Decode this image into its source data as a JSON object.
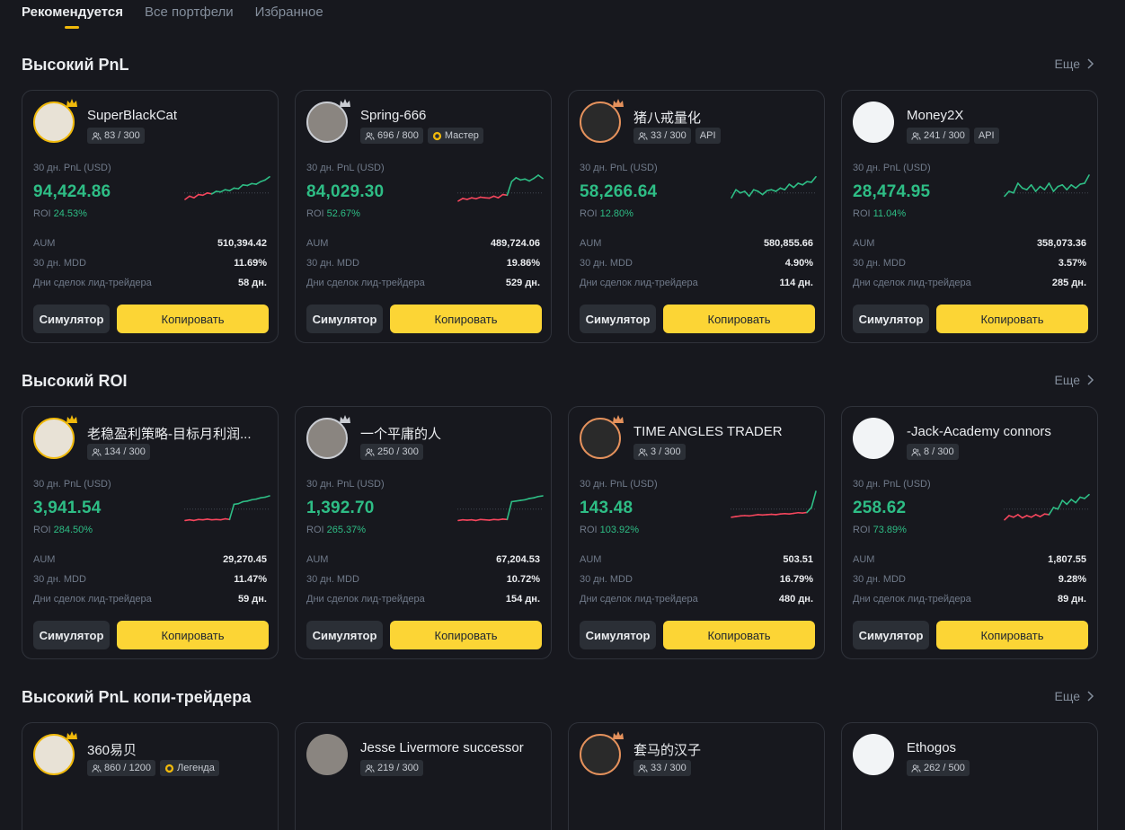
{
  "tabs": [
    {
      "label": "Рекомендуется",
      "active": true
    },
    {
      "label": "Все портфели",
      "active": false
    },
    {
      "label": "Избранное",
      "active": false
    }
  ],
  "labels": {
    "pnl": "30 дн. PnL (USD)",
    "roi": "ROI",
    "aum": "AUM",
    "mdd": "30 дн. MDD",
    "days": "Дни сделок лид-трейдера",
    "simulator": "Симулятор",
    "copy": "Копировать",
    "more": "Еще"
  },
  "colors": {
    "accent": "#fcd535",
    "profit": "#2ebd85",
    "loss": "#f6465d",
    "gold_frame": "#f0b90b",
    "silver_frame": "#c9ccd2",
    "bronze_frame": "#e4915c"
  },
  "sections": [
    {
      "title": "Высокий PnL",
      "cards": [
        {
          "name": "SuperBlackCat",
          "followers": "83 / 300",
          "tag": "",
          "tag_icon": "",
          "frame": "gold",
          "pnl": "94,424.86",
          "roi": "24.53%",
          "aum": "510,394.42",
          "mdd": "11.69%",
          "days": "58 дн.",
          "spark": [
            0.25,
            0.35,
            0.3,
            0.4,
            0.38,
            0.45,
            0.42,
            0.5,
            0.48,
            0.55,
            0.52,
            0.6,
            0.58,
            0.7,
            0.68,
            0.74,
            0.72,
            0.8,
            0.85,
            0.95
          ]
        },
        {
          "name": "Spring-666",
          "followers": "696 / 800",
          "tag": "Мастер",
          "tag_icon": "medal-icon",
          "frame": "silver",
          "pnl": "84,029.30",
          "roi": "52.67%",
          "aum": "489,724.06",
          "mdd": "19.86%",
          "days": "529 дн.",
          "spark": [
            0.2,
            0.28,
            0.25,
            0.3,
            0.27,
            0.32,
            0.3,
            0.29,
            0.35,
            0.3,
            0.4,
            0.38,
            0.8,
            0.92,
            0.85,
            0.88,
            0.82,
            0.9,
            1.0,
            0.9
          ]
        },
        {
          "name": "猪八戒量化",
          "followers": "33 / 300",
          "tag": "API",
          "tag_icon": "",
          "frame": "bronze",
          "pnl": "58,266.64",
          "roi": "12.80%",
          "aum": "580,855.66",
          "mdd": "4.90%",
          "days": "114 дн.",
          "spark": [
            0.3,
            0.55,
            0.45,
            0.5,
            0.35,
            0.55,
            0.5,
            0.4,
            0.52,
            0.55,
            0.5,
            0.6,
            0.55,
            0.72,
            0.62,
            0.75,
            0.7,
            0.8,
            0.78,
            0.95
          ]
        },
        {
          "name": "Money2X",
          "followers": "241 / 300",
          "tag": "API",
          "tag_icon": "",
          "frame": "none",
          "pnl": "28,474.95",
          "roi": "11.04%",
          "aum": "358,073.36",
          "mdd": "3.57%",
          "days": "285 дн.",
          "spark": [
            0.35,
            0.5,
            0.45,
            0.75,
            0.6,
            0.55,
            0.7,
            0.5,
            0.65,
            0.55,
            0.75,
            0.5,
            0.65,
            0.7,
            0.55,
            0.7,
            0.6,
            0.72,
            0.75,
            1.0
          ]
        }
      ]
    },
    {
      "title": "Высокий ROI",
      "cards": [
        {
          "name": "老稳盈利策略-目标月利润...",
          "followers": "134 / 300",
          "tag": "",
          "tag_icon": "",
          "frame": "gold",
          "pnl": "3,941.54",
          "roi": "284.50%",
          "aum": "29,270.45",
          "mdd": "11.47%",
          "days": "59 дн.",
          "spark": [
            0.1,
            0.12,
            0.1,
            0.13,
            0.12,
            0.14,
            0.12,
            0.13,
            0.12,
            0.15,
            0.13,
            0.6,
            0.62,
            0.68,
            0.7,
            0.74,
            0.76,
            0.8,
            0.82,
            0.86
          ]
        },
        {
          "name": "一个平庸的人",
          "followers": "250 / 300",
          "tag": "",
          "tag_icon": "",
          "frame": "silver",
          "pnl": "1,392.70",
          "roi": "265.37%",
          "aum": "67,204.53",
          "mdd": "10.72%",
          "days": "154 дн.",
          "spark": [
            0.1,
            0.12,
            0.11,
            0.12,
            0.1,
            0.13,
            0.12,
            0.11,
            0.13,
            0.12,
            0.14,
            0.13,
            0.68,
            0.7,
            0.72,
            0.74,
            0.78,
            0.8,
            0.84,
            0.86
          ]
        },
        {
          "name": "TIME ANGLES TRADER",
          "followers": "3 / 300",
          "tag": "",
          "tag_icon": "",
          "frame": "bronze",
          "pnl": "143.48",
          "roi": "103.92%",
          "aum": "503.51",
          "mdd": "16.79%",
          "days": "480 дн.",
          "spark": [
            0.2,
            0.22,
            0.24,
            0.25,
            0.24,
            0.26,
            0.28,
            0.27,
            0.28,
            0.29,
            0.28,
            0.3,
            0.31,
            0.3,
            0.32,
            0.34,
            0.33,
            0.35,
            0.5,
            1.0
          ]
        },
        {
          "name": "-Jack-Academy connors",
          "followers": "8 / 300",
          "tag": "",
          "tag_icon": "",
          "frame": "none",
          "pnl": "258.62",
          "roi": "73.89%",
          "aum": "1,807.55",
          "mdd": "9.28%",
          "days": "89 дн.",
          "spark": [
            0.12,
            0.25,
            0.2,
            0.28,
            0.18,
            0.25,
            0.2,
            0.28,
            0.22,
            0.3,
            0.28,
            0.5,
            0.45,
            0.72,
            0.6,
            0.75,
            0.65,
            0.82,
            0.78,
            0.9
          ]
        }
      ]
    },
    {
      "title": "Высокий PnL копи-трейдера",
      "cards": [
        {
          "name": "360易贝",
          "followers": "860 / 1200",
          "tag": "Легенда",
          "tag_icon": "medal-icon",
          "frame": "gold"
        },
        {
          "name": "Jesse Livermore successor",
          "followers": "219 / 300",
          "tag": "",
          "tag_icon": "",
          "frame": "none"
        },
        {
          "name": "套马的汉子",
          "followers": "33 / 300",
          "tag": "",
          "tag_icon": "",
          "frame": "bronze"
        },
        {
          "name": "Ethogos",
          "followers": "262 / 500",
          "tag": "",
          "tag_icon": "",
          "frame": "none"
        }
      ]
    }
  ]
}
